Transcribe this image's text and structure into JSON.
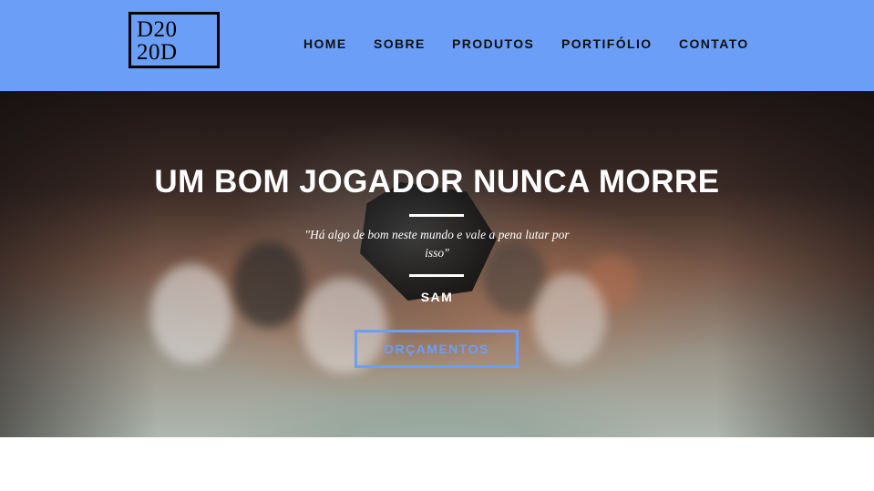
{
  "header": {
    "logo_line1": "D20",
    "logo_line2": "20D",
    "nav": [
      {
        "label": "HOME"
      },
      {
        "label": "SOBRE"
      },
      {
        "label": "PRODUTOS"
      },
      {
        "label": "PORTIFÓLIO"
      },
      {
        "label": "CONTATO"
      }
    ]
  },
  "hero": {
    "title": "UM BOM JOGADOR NUNCA MORRE",
    "quote": "\"Há algo de bom neste mundo e vale a pena lutar por isso\"",
    "author": "SAM",
    "cta_label": "ORÇAMENTOS"
  },
  "colors": {
    "navbar": "#6b9ef7",
    "accent": "#6b9ef7",
    "text_light": "#ffffff",
    "text_dark": "#111111"
  }
}
